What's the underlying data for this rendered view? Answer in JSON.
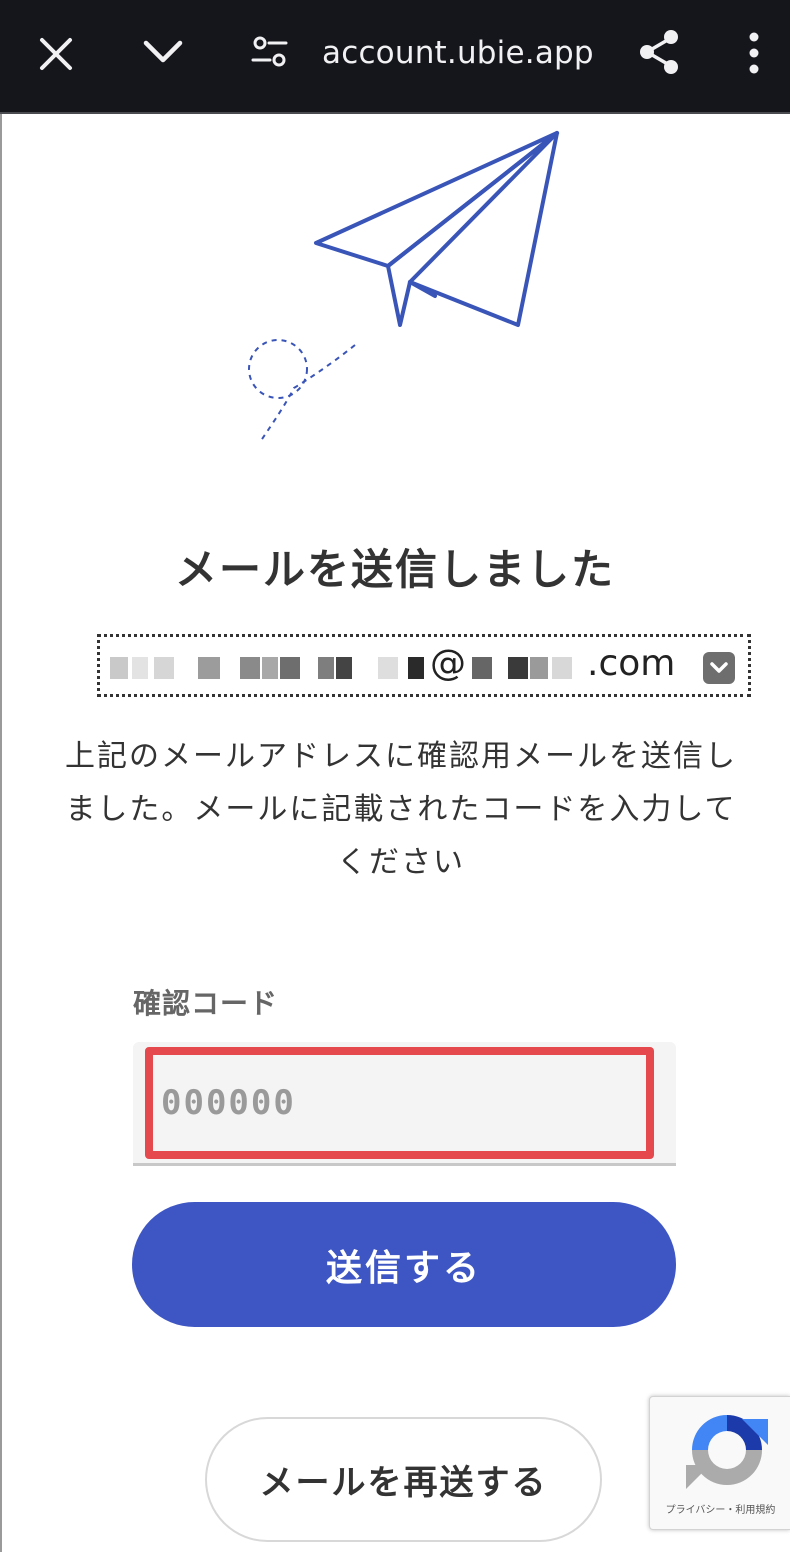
{
  "browser": {
    "url": "account.ubie.app",
    "icons": [
      "close-icon",
      "chevron-down-icon",
      "site-settings-icon",
      "share-icon",
      "more-vert-icon"
    ]
  },
  "colors": {
    "topbar_bg": "#15161c",
    "primary": "#3e56c4",
    "illustration": "#3a55b8",
    "highlight_border": "#e5484d"
  },
  "page": {
    "heading": "メールを送信しました",
    "email_visible_suffix": "@",
    "email_domain_suffix": ".com",
    "description": "上記のメールアドレスに確認用メールを送信しました。メールに記載されたコードを入力してください",
    "code_label": "確認コード",
    "code_placeholder": "000000",
    "submit_label": "送信する",
    "resend_label": "メールを再送する"
  },
  "recaptcha": {
    "links": "プライバシー・利用規約"
  }
}
